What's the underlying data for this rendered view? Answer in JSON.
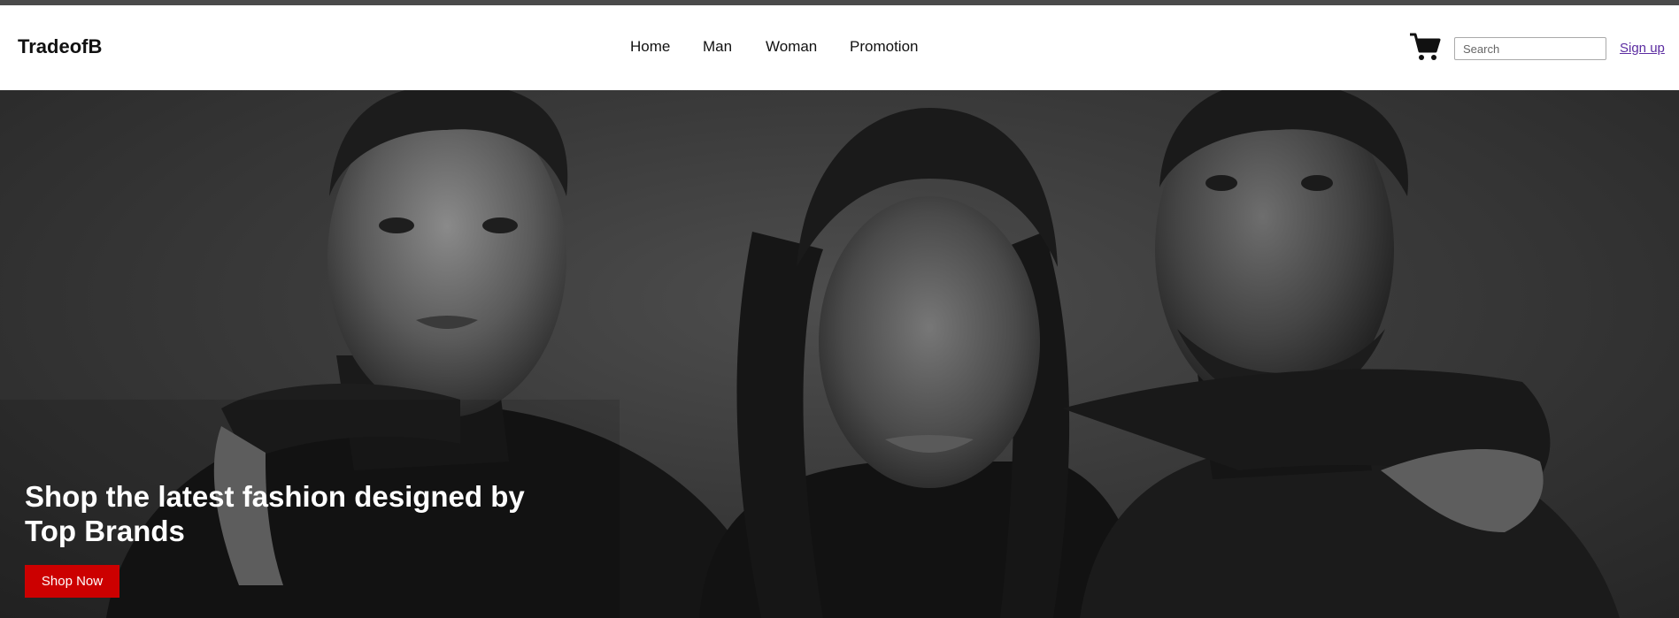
{
  "brand": {
    "name": "TradeofB"
  },
  "nav": {
    "items": [
      {
        "label": "Home"
      },
      {
        "label": "Man"
      },
      {
        "label": "Woman"
      },
      {
        "label": "Promotion"
      }
    ]
  },
  "header": {
    "cart_icon": "shopping-cart-icon",
    "search": {
      "placeholder": "Search",
      "value": ""
    },
    "signup_label": "Sign up"
  },
  "hero": {
    "headline": "Shop the latest fashion designed by Top Brands",
    "cta_label": "Shop Now",
    "image_style": "black-and-white portrait"
  },
  "colors": {
    "topbar": "#4a4a4a",
    "cta": "#cc0000",
    "signup_link": "#5b2ca1",
    "text": "#111111"
  }
}
